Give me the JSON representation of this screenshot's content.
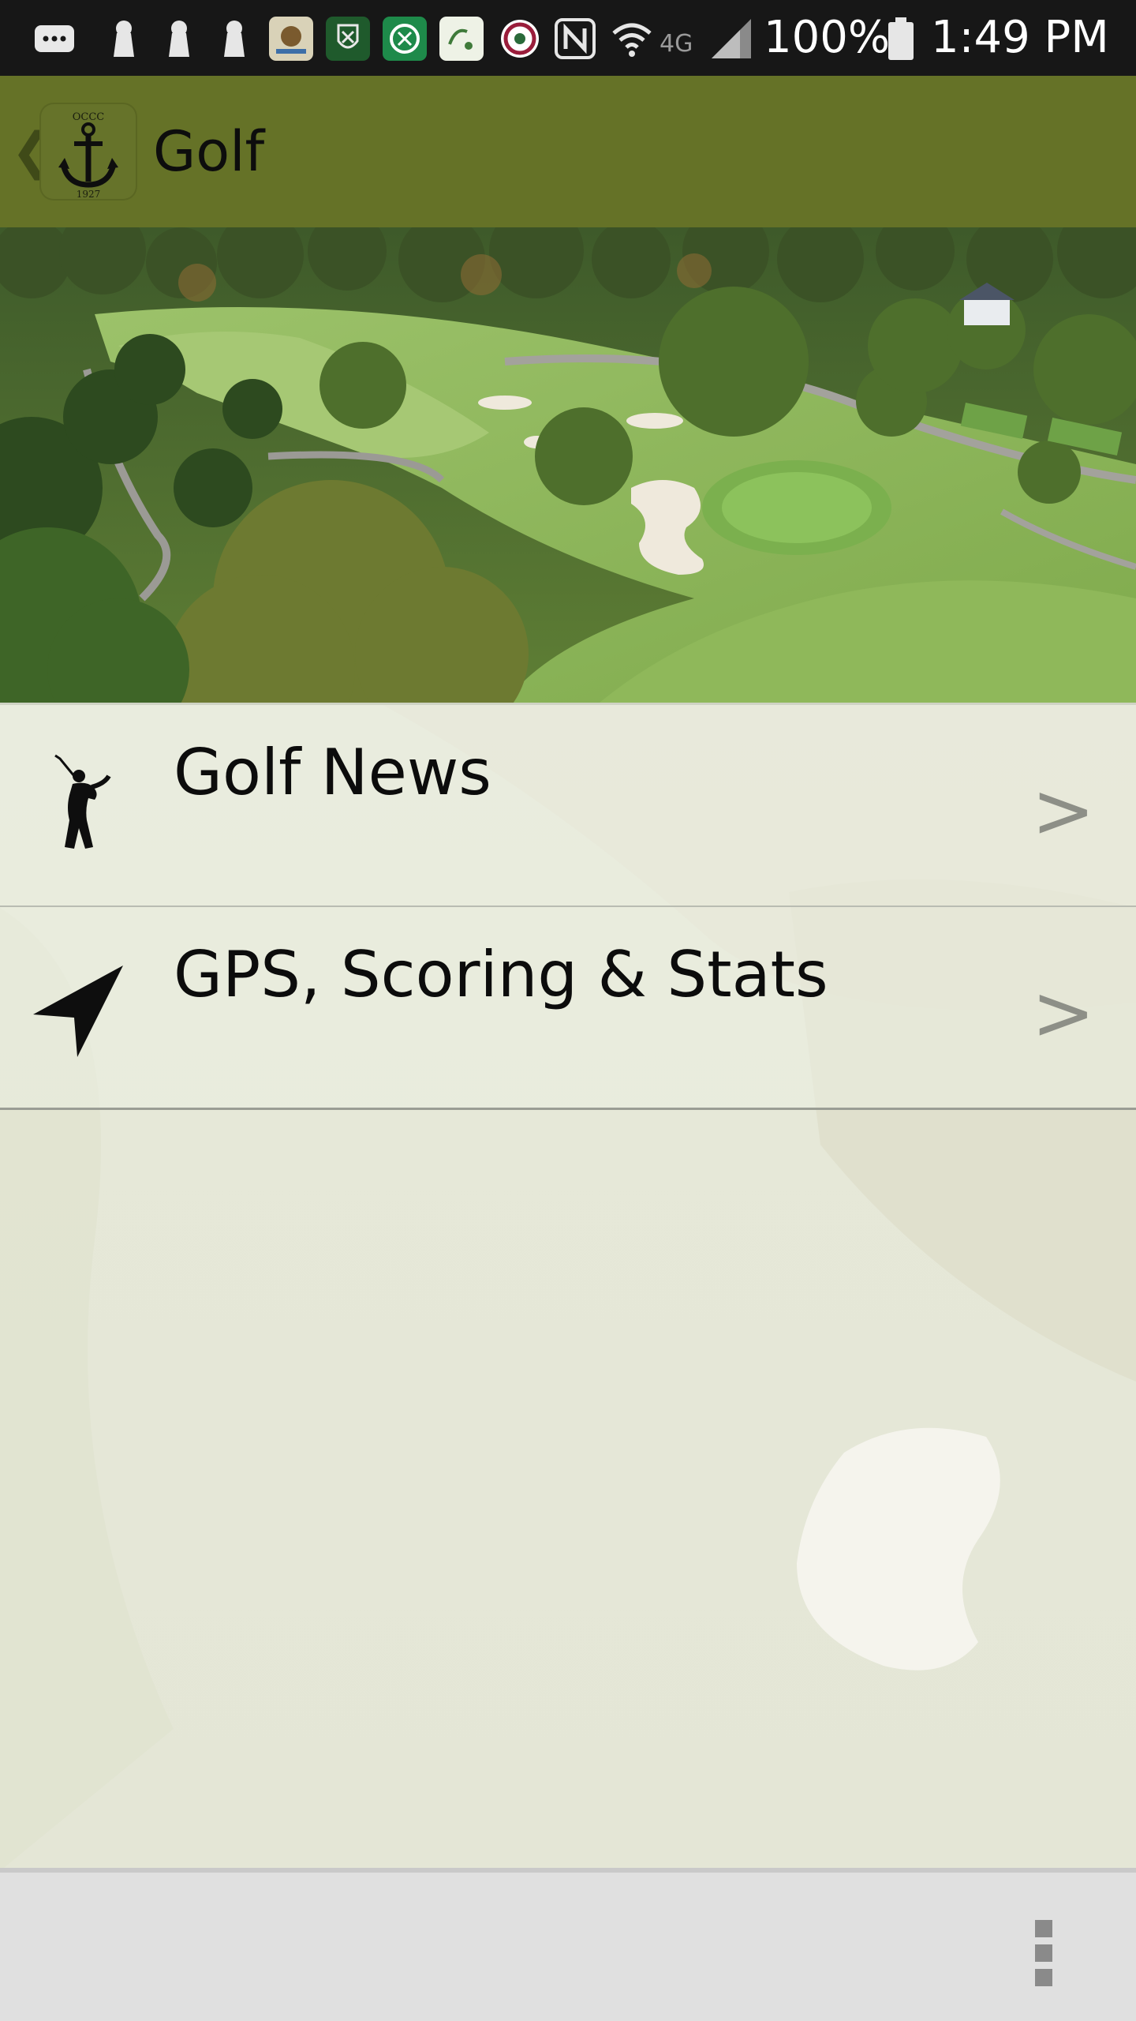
{
  "status_bar": {
    "battery": "100%",
    "time": "1:49 PM",
    "network": "4G",
    "icons": [
      "chat-bubble-icon",
      "keyhole-icon",
      "keyhole-icon",
      "keyhole-icon",
      "bear-app-icon",
      "club-crest-app-icon",
      "green-crest-app-icon",
      "club-app-icon",
      "seal-app-icon",
      "nfc-icon",
      "wifi-icon",
      "signal-icon",
      "battery-icon"
    ]
  },
  "app_bar": {
    "back_icon": "chevron-left-icon",
    "logo_text_top": "OCCC",
    "logo_text_bottom": "1927",
    "title": "Golf",
    "color": "#657227"
  },
  "hero": {
    "image": "aerial-golf-course-photo"
  },
  "menu": {
    "items": [
      {
        "label": "Golf News",
        "icon": "golfer-silhouette-icon",
        "chevron": ">"
      },
      {
        "label": "GPS, Scoring & Stats",
        "icon": "navigation-arrow-icon",
        "chevron": ">"
      }
    ]
  },
  "bottom_bar": {
    "icon": "overflow-menu-icon"
  }
}
